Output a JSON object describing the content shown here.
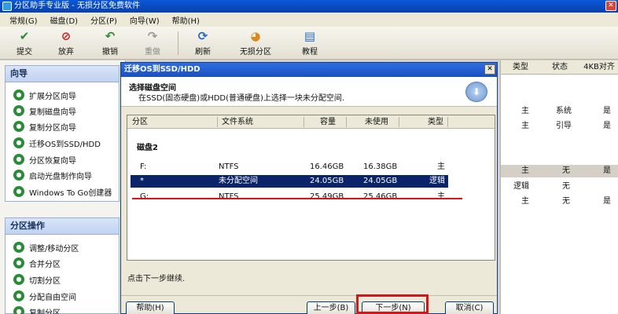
{
  "window": {
    "title": "分区助手专业版 - 无损分区免费软件",
    "close": "✕"
  },
  "menu": [
    "常规(G)",
    "磁盘(D)",
    "分区(P)",
    "向导(W)",
    "帮助(H)"
  ],
  "toolbar": {
    "submit": "提交",
    "discard": "放弃",
    "undo": "撤销",
    "redo": "重做",
    "refresh": "刷新",
    "lossless": "无损分区",
    "tutorial": "教程"
  },
  "left": {
    "wizard_title": "向导",
    "wizard_items": [
      "扩展分区向导",
      "复制磁盘向导",
      "复制分区向导",
      "迁移OS到SSD/HDD",
      "分区恢复向导",
      "启动光盘制作向导",
      "Windows To Go创建器"
    ],
    "ops_title": "分区操作",
    "ops_items": [
      "调整/移动分区",
      "合并分区",
      "切割分区",
      "分配自由空间",
      "复制分区"
    ]
  },
  "right": {
    "headers": [
      "类型",
      "状态",
      "4KB对齐"
    ],
    "rows": [
      {
        "type": "主",
        "status": "系统",
        "align": "是",
        "selected": false
      },
      {
        "type": "主",
        "status": "引导",
        "align": "是",
        "selected": false
      },
      {
        "type": "主",
        "status": "无",
        "align": "是",
        "selected": true
      },
      {
        "type": "逻辑",
        "status": "无",
        "align": "",
        "selected": false
      },
      {
        "type": "主",
        "status": "无",
        "align": "是",
        "selected": false
      }
    ]
  },
  "dialog": {
    "title": "迁移OS到SSD/HDD",
    "close": "✕",
    "heading": "选择磁盘空间",
    "subheading": "在SSD(固态硬盘)或HDD(普通硬盘)上选择一块未分配空间.",
    "columns": [
      "分区",
      "文件系统",
      "容量",
      "未使用",
      "类型"
    ],
    "disk_label": "磁盘2",
    "rows": [
      {
        "part": "F:",
        "fs": "NTFS",
        "cap": "16.46GB",
        "free": "16.38GB",
        "type": "主",
        "selected": false
      },
      {
        "part": "*",
        "fs": "未分配空间",
        "cap": "24.05GB",
        "free": "24.05GB",
        "type": "逻辑",
        "selected": true
      },
      {
        "part": "G:",
        "fs": "NTFS",
        "cap": "25.49GB",
        "free": "25.46GB",
        "type": "主",
        "selected": false
      }
    ],
    "hint": "点击下一步继续.",
    "buttons": {
      "help": "帮助(H)",
      "back": "上一步(B)",
      "next": "下一步(N)",
      "cancel": "取消(C)"
    }
  },
  "colors": {
    "selection": "#0a246a",
    "annotation_red": "#d8141b",
    "title_blue": "#0a58d8"
  }
}
